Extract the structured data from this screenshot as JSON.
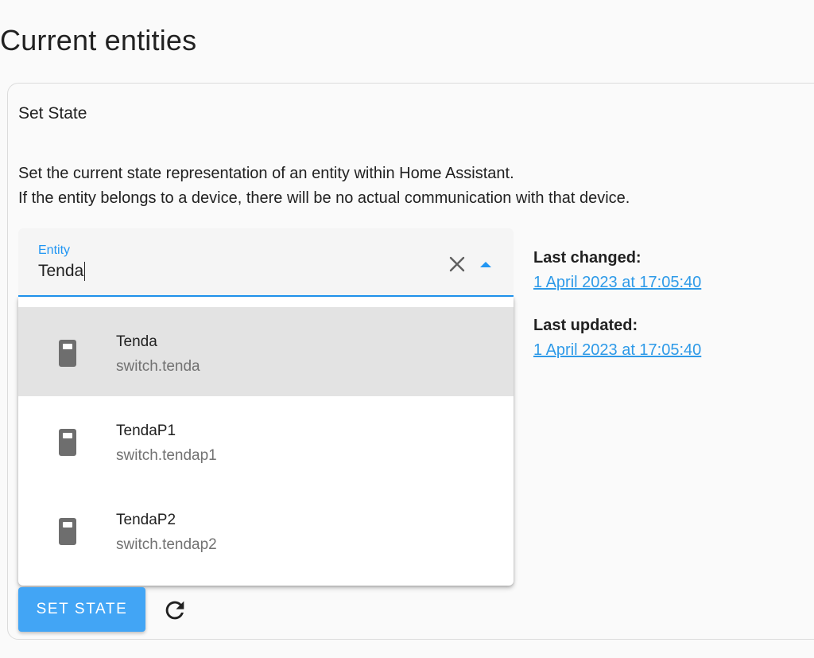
{
  "page": {
    "title": "Current entities"
  },
  "card": {
    "title": "Set State",
    "description_line1": "Set the current state representation of an entity within Home Assistant.",
    "description_line2": "If the entity belongs to a device, there will be no actual communication with that device."
  },
  "entity_field": {
    "label": "Entity",
    "value": "Tenda",
    "clear_icon": "close-icon",
    "open_icon": "menu-up-icon"
  },
  "dropdown": {
    "items": [
      {
        "name": "Tenda",
        "entity_id": "switch.tenda",
        "icon": "light-switch-icon",
        "highlighted": true
      },
      {
        "name": "TendaP1",
        "entity_id": "switch.tendap1",
        "icon": "light-switch-icon",
        "highlighted": false
      },
      {
        "name": "TendaP2",
        "entity_id": "switch.tendap2",
        "icon": "light-switch-icon",
        "highlighted": false
      }
    ]
  },
  "meta": {
    "last_changed_label": "Last changed:",
    "last_changed_value": "1 April 2023 at 17:05:40",
    "last_updated_label": "Last updated:",
    "last_updated_value": "1 April 2023 at 17:05:40"
  },
  "actions": {
    "set_state_label": "SET STATE",
    "refresh_icon": "refresh-icon"
  },
  "colors": {
    "accent": "#2196f3",
    "button": "#42a5f5",
    "link": "#2e9ae8",
    "highlight": "#e3e3e3"
  }
}
